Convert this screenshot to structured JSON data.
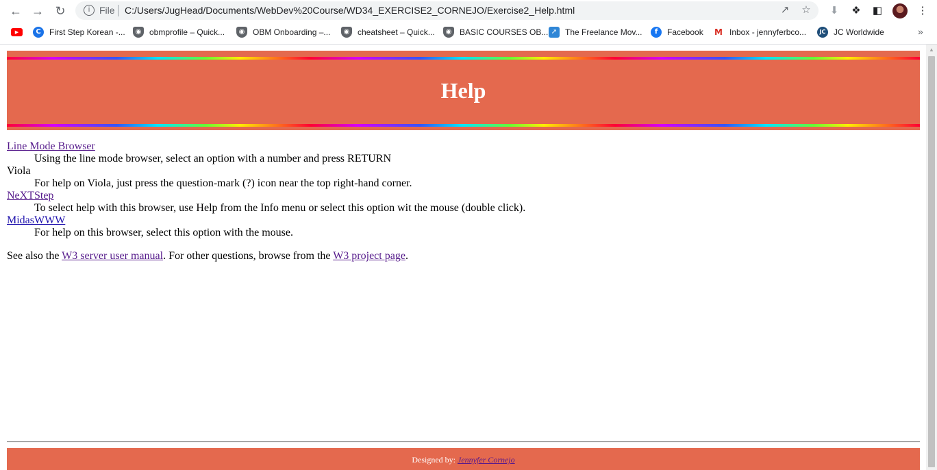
{
  "browser": {
    "omnibox": {
      "file_label": "File",
      "url": "C:/Users/JugHead/Documents/WebDev%20Course/WD34_EXERCISE2_CORNEJO/Exercise2_Help.html"
    },
    "bookmarks": [
      {
        "label": ""
      },
      {
        "label": "First Step Korean -..."
      },
      {
        "label": "obmprofile – Quick..."
      },
      {
        "label": "OBM Onboarding –..."
      },
      {
        "label": "cheatsheet – Quick..."
      },
      {
        "label": "BASIC COURSES OB..."
      },
      {
        "label": "The Freelance Mov..."
      },
      {
        "label": "Facebook"
      },
      {
        "label": "Inbox - jennyferbco..."
      },
      {
        "label": "JC Worldwide"
      }
    ],
    "more_label": "»"
  },
  "page": {
    "title": "Help",
    "entries": [
      {
        "term": "Line Mode Browser",
        "description": "Using the line mode browser, select an option with a number and press RETURN"
      },
      {
        "term": "Viola",
        "description": "For help on Viola, just press the question-mark (?) icon near the top right-hand corner."
      },
      {
        "term": "NeXTStep",
        "description": "To select help with this browser, use Help from the Info menu or select this option wit the mouse (double click)."
      },
      {
        "term": "MidasWWW",
        "description": "For help on this browser, select this option with the mouse."
      }
    ],
    "see_also": {
      "prefix": "See also the ",
      "link1": "W3 server user manual",
      "middle": ". For other questions, browse from the ",
      "link2": "W3 project page",
      "suffix": "."
    },
    "footer": {
      "prefix": "Designed by: ",
      "author": "Jennyfer Cornejo"
    }
  },
  "colors": {
    "header_bg": "#e4694e",
    "link": "#1a0dab",
    "visited_link": "#551a8b"
  }
}
